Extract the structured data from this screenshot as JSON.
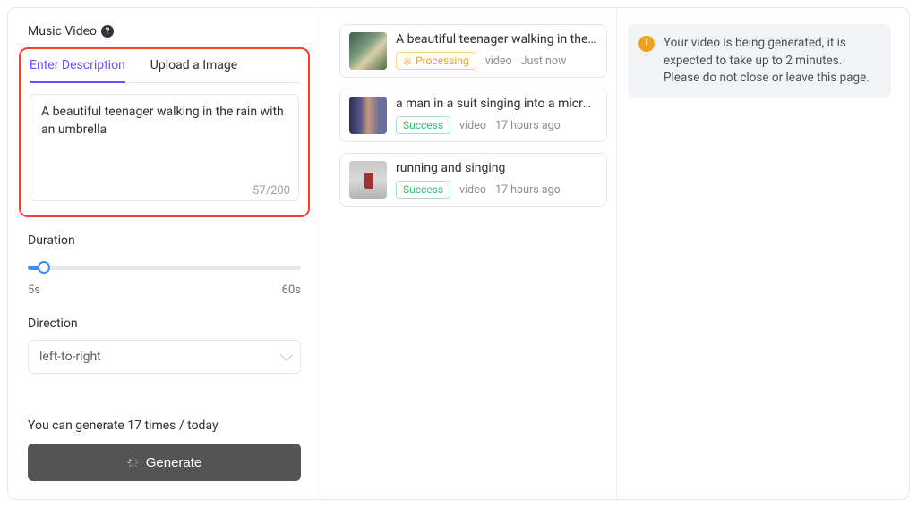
{
  "left": {
    "section_title": "Music Video",
    "tabs": {
      "description": "Enter Description",
      "upload": "Upload a Image",
      "active": "description"
    },
    "description_value": "A beautiful teenager walking in the rain with an umbrella",
    "char_count": "57/200",
    "duration_label": "Duration",
    "duration_min": "5s",
    "duration_max": "60s",
    "direction_label": "Direction",
    "direction_value": "left-to-right",
    "quota_text": "You can generate 17 times / today",
    "generate_label": "Generate"
  },
  "queue": [
    {
      "title": "A beautiful teenager walking in the rain...",
      "status": "Processing",
      "status_kind": "processing",
      "type": "video",
      "time": "Just now"
    },
    {
      "title": "a man in a suit singing into a microphone",
      "status": "Success",
      "status_kind": "success",
      "type": "video",
      "time": "17 hours ago"
    },
    {
      "title": "running and singing",
      "status": "Success",
      "status_kind": "success",
      "type": "video",
      "time": "17 hours ago"
    }
  ],
  "notice": {
    "text": "Your video is being generated, it is expected to take up to 2 minutes. Please do not close or leave this page."
  }
}
